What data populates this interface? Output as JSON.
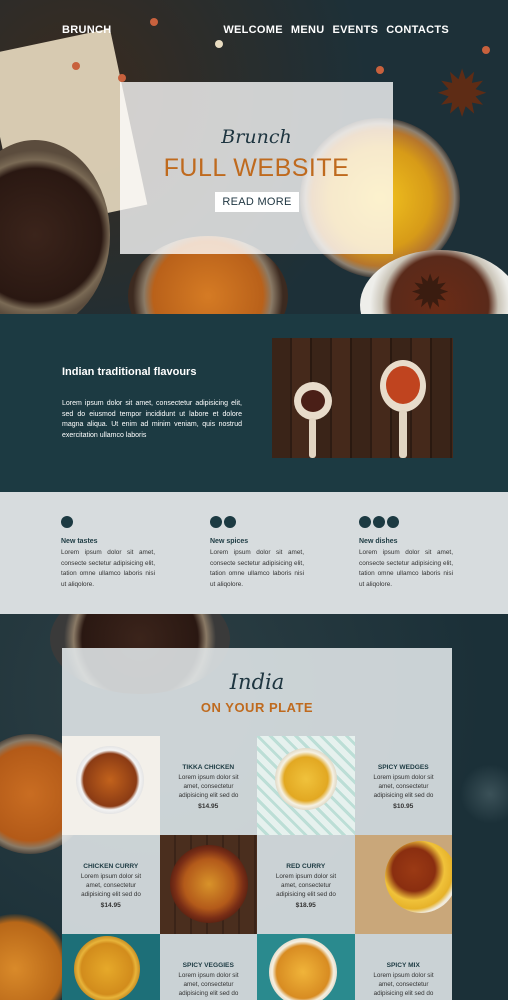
{
  "nav": {
    "brand": "BRUNCH",
    "items": [
      "WELCOME",
      "MENU",
      "EVENTS",
      "CONTACTS"
    ]
  },
  "hero": {
    "script_title": "Brunch",
    "title": "FULL WEBSITE",
    "button_label": "READ MORE"
  },
  "about": {
    "heading": "Indian traditional flavours",
    "text": "Lorem ipsum dolor sit amet, consectetur adipisicing elit, sed do eiusmod tempor incididunt ut labore et dolore magna aliqua. Ut enim ad minim veniam, quis nostrud exercitation ullamco laboris"
  },
  "features": [
    {
      "dots": 1,
      "title": "New tastes",
      "text": "Lorem ipsum dolor sit amet, consecte sectetur adipisicing elit, tation omne ullamco laboris nisi ut aliqolore."
    },
    {
      "dots": 2,
      "title": "New spices",
      "text": "Lorem ipsum dolor sit amet, consecte sectetur adipisicing elit, tation omne ullamco laboris nisi ut aliqolore."
    },
    {
      "dots": 3,
      "title": "New dishes",
      "text": "Lorem ipsum dolor sit amet, consecte sectetur adipisicing elit, tation omne ullamco laboris nisi ut aliqolore."
    }
  ],
  "menu": {
    "script_title": "India",
    "title": "ON YOUR PLATE",
    "items": [
      {
        "name": "TIKKA CHICKEN",
        "desc": "Lorem ipsum dolor sit amet, consectetur adipisicing elit sed do",
        "price": "$14.95"
      },
      {
        "name": "SPICY WEDGES",
        "desc": "Lorem ipsum dolor sit amet, consectetur adipisicing elit sed do",
        "price": "$10.95"
      },
      {
        "name": "CHICKEN CURRY",
        "desc": "Lorem ipsum dolor sit amet, consectetur adipisicing elit sed do",
        "price": "$14.95"
      },
      {
        "name": "RED CURRY",
        "desc": "Lorem ipsum dolor sit amet, consectetur adipisicing elit sed do",
        "price": "$18.95"
      },
      {
        "name": "SPICY VEGGIES",
        "desc": "Lorem ipsum dolor sit amet, consectetur adipisicing elit sed do",
        "price": ""
      },
      {
        "name": "SPICY MIX",
        "desc": "Lorem ipsum dolor sit amet, consectetur adipisicing elit sed do",
        "price": ""
      }
    ]
  },
  "colors": {
    "accent": "#bf6a1e",
    "dark_teal": "#1c3a42",
    "light_band": "#d7dcde"
  }
}
